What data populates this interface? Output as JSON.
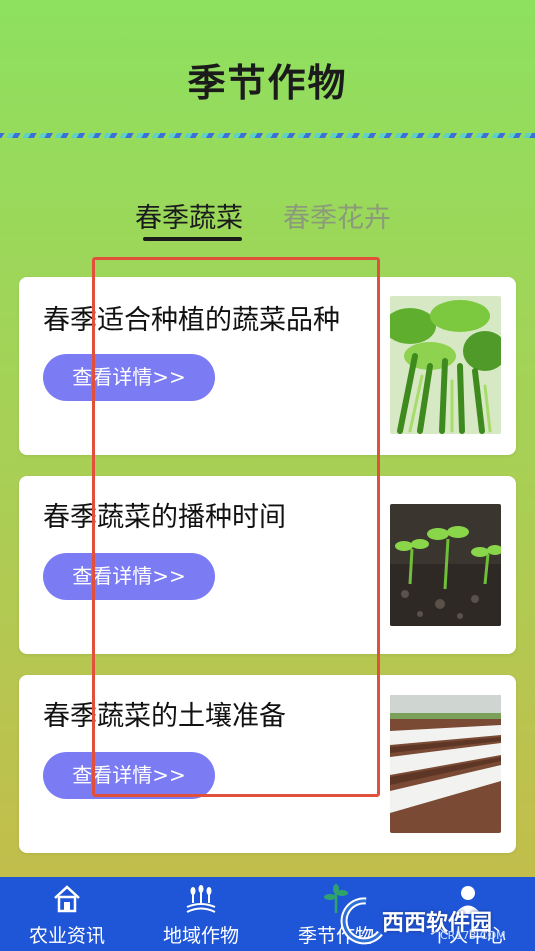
{
  "header": {
    "title": "季节作物"
  },
  "tabs": [
    {
      "label": "春季蔬菜",
      "active": true
    },
    {
      "label": "春季花卉",
      "active": false
    }
  ],
  "articles": [
    {
      "title": "春季适合种植的蔬菜品种",
      "button_label": "查看详情>>",
      "image": "leafy-vegetable-photo"
    },
    {
      "title": "春季蔬菜的播种时间",
      "button_label": "查看详情>>",
      "image": "seedlings-soil-photo"
    },
    {
      "title": "春季蔬菜的土壤准备",
      "button_label": "查看详情>>",
      "image": "plastic-mulch-field-photo"
    }
  ],
  "bottom_nav": [
    {
      "label": "农业资讯",
      "icon": "house-icon"
    },
    {
      "label": "地域作物",
      "icon": "wheat-field-icon"
    },
    {
      "label": "季节作物",
      "icon": "plant-icon"
    },
    {
      "label": "个人中心",
      "icon": "person-icon"
    }
  ],
  "watermark": {
    "text": "西西软件园",
    "sub": "CR173.COM"
  },
  "colors": {
    "background_top": "#8ee05f",
    "background_bottom": "#c3bc4a",
    "button": "#7b7cf4",
    "nav_bar": "#1f56d8",
    "highlight_box": "#e0503a",
    "tab_inactive": "#8b9a7a"
  }
}
